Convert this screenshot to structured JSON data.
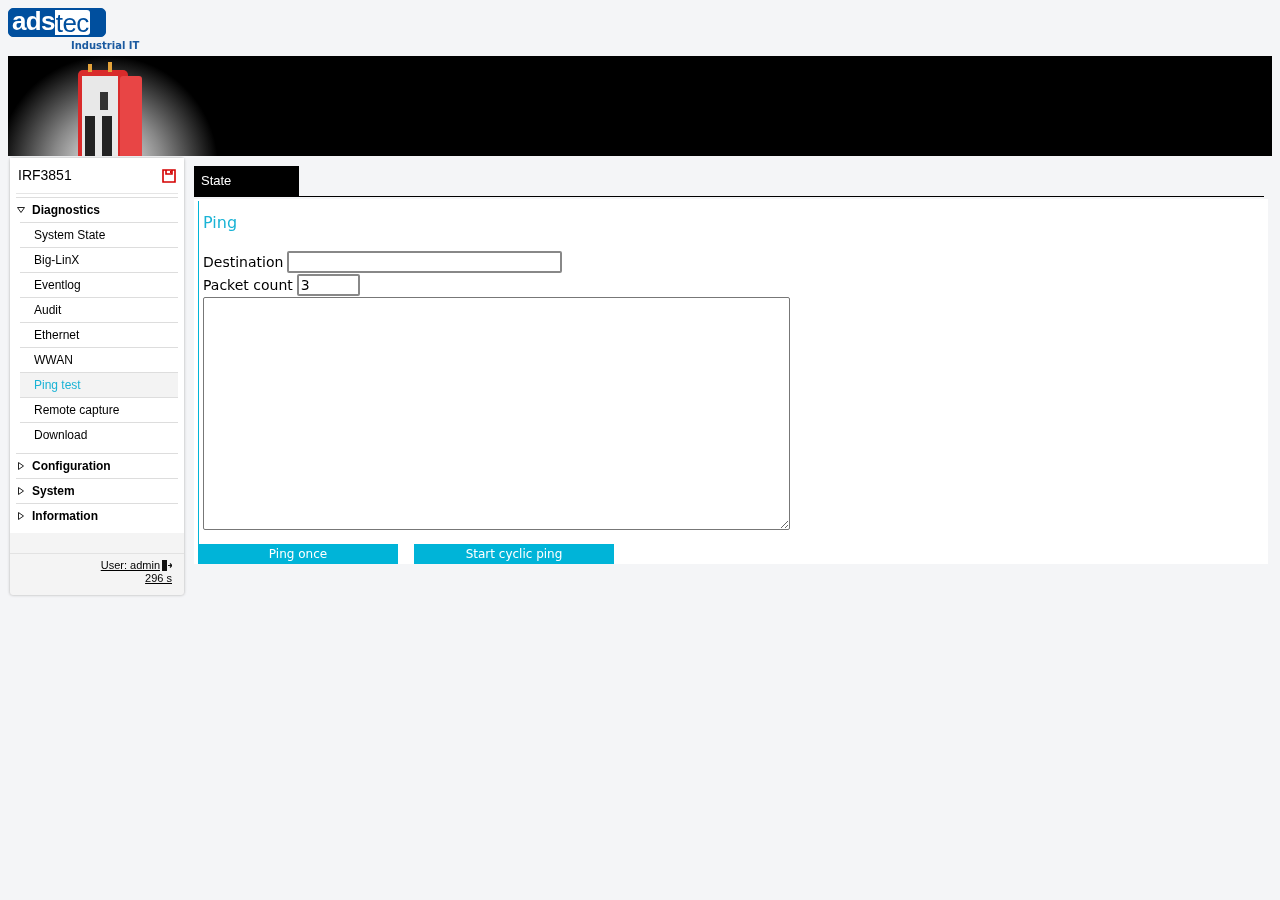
{
  "logo": {
    "part_1": "ads",
    "part_2": "tec",
    "tagline": "Industrial IT"
  },
  "sidebar": {
    "device": "IRF3851",
    "groups": [
      {
        "label": "Diagnostics",
        "expanded": true,
        "items": [
          {
            "label": "System State",
            "selected": false
          },
          {
            "label": "Big-LinX",
            "selected": false
          },
          {
            "label": "Eventlog",
            "selected": false
          },
          {
            "label": "Audit",
            "selected": false
          },
          {
            "label": "Ethernet",
            "selected": false
          },
          {
            "label": "WWAN",
            "selected": false
          },
          {
            "label": "Ping test",
            "selected": true
          },
          {
            "label": "Remote capture",
            "selected": false
          },
          {
            "label": "Download",
            "selected": false
          }
        ]
      },
      {
        "label": "Configuration",
        "expanded": false
      },
      {
        "label": "System",
        "expanded": false
      },
      {
        "label": "Information",
        "expanded": false
      }
    ],
    "user": "User: admin",
    "timer": "296 s"
  },
  "tabs": [
    {
      "label": "State",
      "selected": true
    }
  ],
  "panel": {
    "title": "Ping",
    "fields": [
      {
        "label": "Destination"
      },
      {
        "label": "Packet count",
        "value": "3"
      }
    ],
    "buttons": [
      "Ping once",
      "Start cyclic ping"
    ]
  }
}
